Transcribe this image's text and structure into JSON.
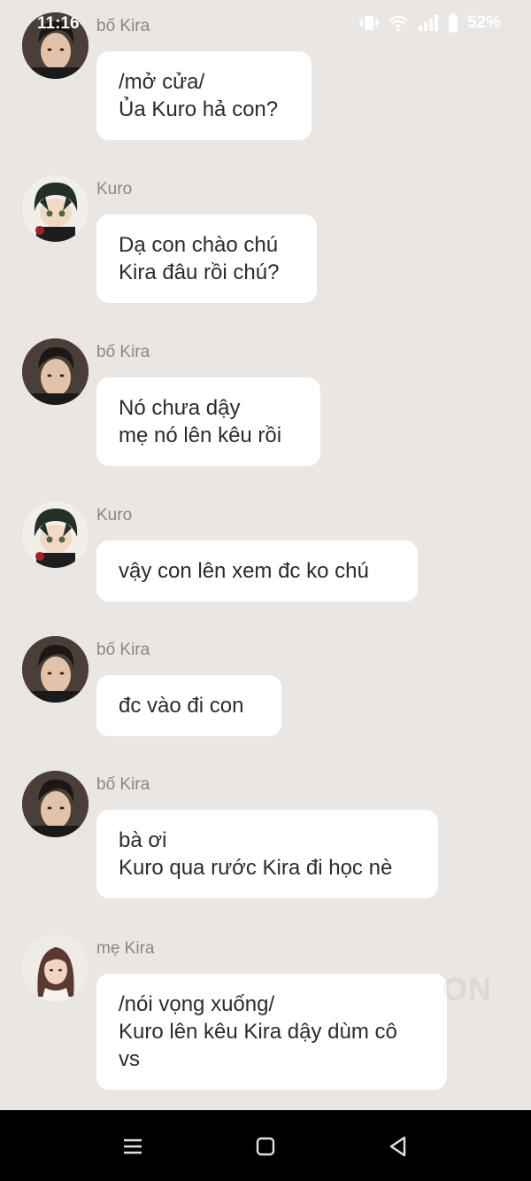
{
  "status_bar": {
    "time": "11:16",
    "battery": "52%",
    "icons": [
      "vibrate-icon",
      "wifi-icon",
      "signal-icon",
      "battery-icon"
    ]
  },
  "messages": [
    {
      "sender": "bố Kira",
      "text": "/mở cửa/\nỦa Kuro hả con?",
      "avatar": "dad-kira-avatar"
    },
    {
      "sender": "Kuro",
      "text": "Dạ con chào chú\nKira đâu rồi chú?",
      "avatar": "kuro-avatar"
    },
    {
      "sender": "bố Kira",
      "text": "Nó chưa dậy\nmẹ nó lên kêu rồi",
      "avatar": "dad-kira-avatar"
    },
    {
      "sender": "Kuro",
      "text": "vậy con lên xem đc ko chú",
      "avatar": "kuro-avatar"
    },
    {
      "sender": "bố Kira",
      "text": "đc vào đi con",
      "avatar": "dad-kira-avatar"
    },
    {
      "sender": "bố Kira",
      "text": "bà ơi\nKuro qua rước Kira đi học nè",
      "avatar": "dad-kira-avatar"
    },
    {
      "sender": "mẹ Kira",
      "text": "/nói vọng xuống/\nKuro lên kêu Kira dậy dùm cô\nvs",
      "avatar": "mom-kira-avatar"
    }
  ],
  "watermark": "ON",
  "nav": {
    "buttons": [
      "menu-icon",
      "home-icon",
      "back-icon"
    ]
  },
  "colors": {
    "background": "#e9e6e4",
    "bubble": "#ffffff",
    "sender": "#8a8785",
    "text": "#2b2b2b",
    "nav_bar": "#000000"
  }
}
